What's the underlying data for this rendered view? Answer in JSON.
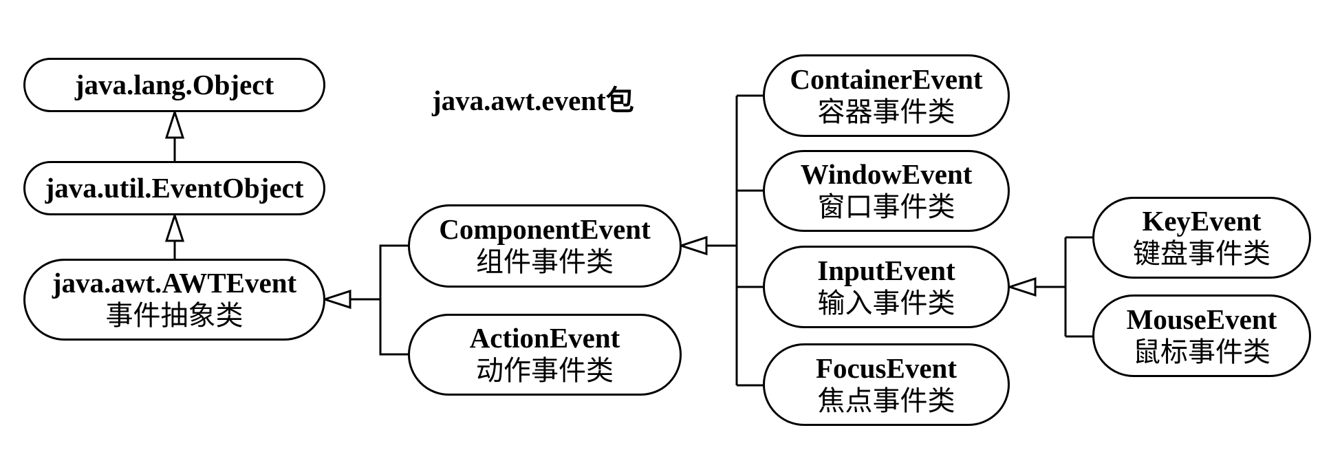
{
  "package_label": {
    "latin": "java.awt.event",
    "cjk": "包"
  },
  "nodes": {
    "object": {
      "en": "java.lang.Object"
    },
    "eventobject": {
      "en": "java.util.EventObject"
    },
    "awtevent": {
      "en": "java.awt.AWTEvent",
      "zh": "事件抽象类"
    },
    "componentevent": {
      "en": "ComponentEvent",
      "zh": "组件事件类"
    },
    "actionevent": {
      "en": "ActionEvent",
      "zh": "动作事件类"
    },
    "containerevent": {
      "en": "ContainerEvent",
      "zh": "容器事件类"
    },
    "windowevent": {
      "en": "WindowEvent",
      "zh": "窗口事件类"
    },
    "inputevent": {
      "en": "InputEvent",
      "zh": "输入事件类"
    },
    "focusevent": {
      "en": "FocusEvent",
      "zh": "焦点事件类"
    },
    "keyevent": {
      "en": "KeyEvent",
      "zh": "键盘事件类"
    },
    "mouseevent": {
      "en": "MouseEvent",
      "zh": "鼠标事件类"
    }
  },
  "inheritance": [
    {
      "child": "eventobject",
      "parent": "object"
    },
    {
      "child": "awtevent",
      "parent": "eventobject"
    },
    {
      "child": "componentevent",
      "parent": "awtevent"
    },
    {
      "child": "actionevent",
      "parent": "awtevent"
    },
    {
      "child": "containerevent",
      "parent": "componentevent"
    },
    {
      "child": "windowevent",
      "parent": "componentevent"
    },
    {
      "child": "inputevent",
      "parent": "componentevent"
    },
    {
      "child": "focusevent",
      "parent": "componentevent"
    },
    {
      "child": "keyevent",
      "parent": "inputevent"
    },
    {
      "child": "mouseevent",
      "parent": "inputevent"
    }
  ]
}
